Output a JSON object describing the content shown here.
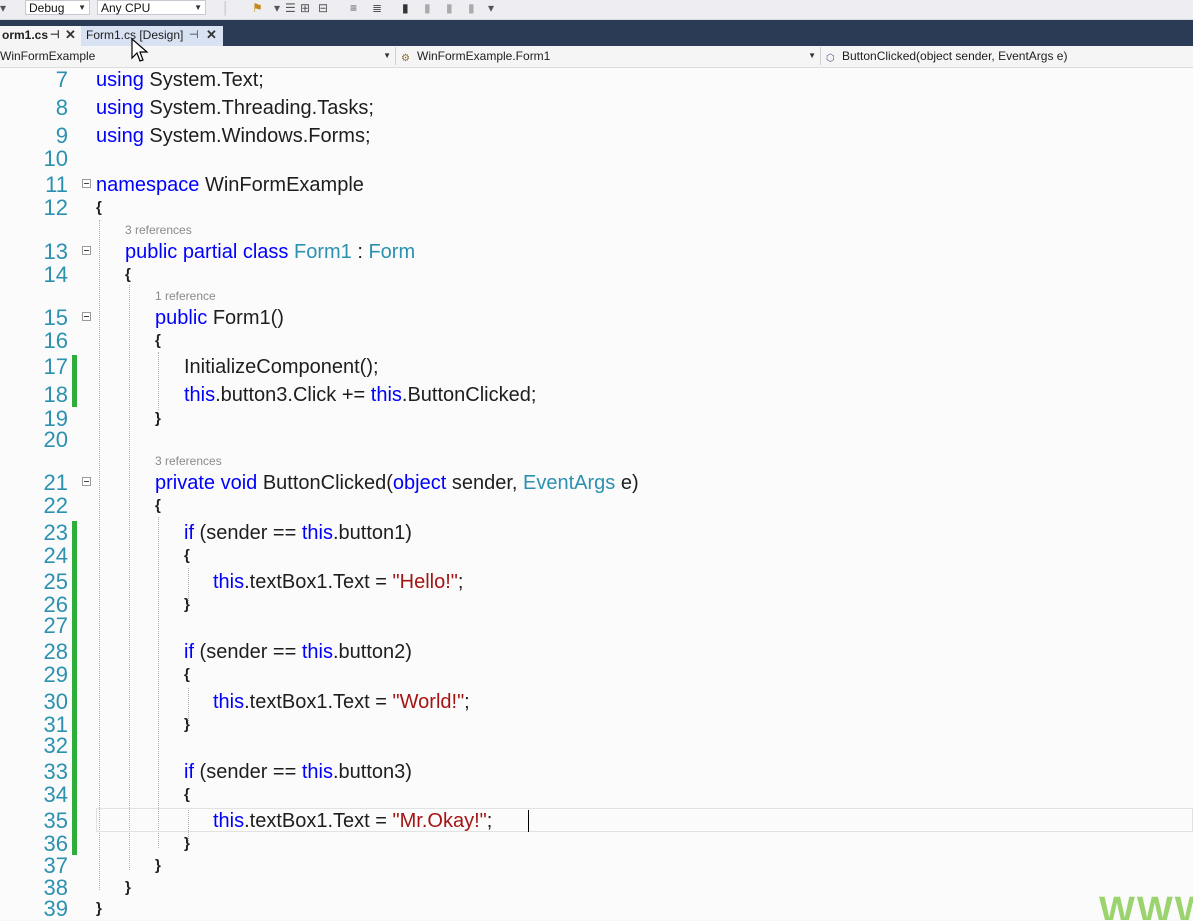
{
  "toolbar": {
    "configuration": "Debug",
    "platform": "Any CPU"
  },
  "tabs": [
    {
      "label": "orm1.cs",
      "active": true
    },
    {
      "label": "Form1.cs [Design]",
      "active": false
    }
  ],
  "navbar": {
    "project": "WinFormExample",
    "type": "WinFormExample.Form1",
    "member": "ButtonClicked(object sender, EventArgs e)"
  },
  "editor": {
    "lines": [
      {
        "n": "7"
      },
      {
        "n": "8"
      },
      {
        "n": "9"
      },
      {
        "n": "10"
      },
      {
        "n": "11"
      },
      {
        "n": "12"
      },
      {
        "n": "13"
      },
      {
        "n": "14"
      },
      {
        "n": "15"
      },
      {
        "n": "16"
      },
      {
        "n": "17"
      },
      {
        "n": "18"
      },
      {
        "n": "19"
      },
      {
        "n": "20"
      },
      {
        "n": "21"
      },
      {
        "n": "22"
      },
      {
        "n": "23"
      },
      {
        "n": "24"
      },
      {
        "n": "25"
      },
      {
        "n": "26"
      },
      {
        "n": "27"
      },
      {
        "n": "28"
      },
      {
        "n": "29"
      },
      {
        "n": "30"
      },
      {
        "n": "31"
      },
      {
        "n": "32"
      },
      {
        "n": "33"
      },
      {
        "n": "34"
      },
      {
        "n": "35"
      },
      {
        "n": "36"
      },
      {
        "n": "37"
      },
      {
        "n": "38"
      },
      {
        "n": "39"
      }
    ],
    "code": {
      "l7": [
        "using",
        " System.Text;"
      ],
      "l8": [
        "using",
        " System.Threading.Tasks;"
      ],
      "l9": [
        "using",
        " System.Windows.Forms;"
      ],
      "l11": [
        "namespace",
        " WinFormExample"
      ],
      "l12": "{",
      "l13": [
        "public partial class",
        " ",
        "Form1",
        " : ",
        "Form"
      ],
      "l14": "{",
      "l15": [
        "public",
        " Form1()"
      ],
      "l16": "{",
      "l17": "InitializeComponent();",
      "l18": [
        "this",
        ".button3.Click += ",
        "this",
        ".ButtonClicked;"
      ],
      "l19": "}",
      "l21": [
        "private void",
        " ButtonClicked(",
        "object",
        " sender, ",
        "EventArgs",
        " e)"
      ],
      "l22": "{",
      "l23": [
        "if",
        " (sender == ",
        "this",
        ".button1)"
      ],
      "l24": "{",
      "l25": [
        "this",
        ".textBox1.Text = ",
        "\"Hello!\"",
        ";"
      ],
      "l26": "}",
      "l28": [
        "if",
        " (sender == ",
        "this",
        ".button2)"
      ],
      "l29": "{",
      "l30": [
        "this",
        ".textBox1.Text = ",
        "\"World!\"",
        ";"
      ],
      "l31": "}",
      "l33": [
        "if",
        " (sender == ",
        "this",
        ".button3)"
      ],
      "l34": "{",
      "l35": [
        "this",
        ".textBox1.Text = ",
        "\"Mr.Okay!\"",
        ";"
      ],
      "l36": "}",
      "l37": "}",
      "l38": "}",
      "l39": "}"
    },
    "codelens": {
      "class_refs": "3 references",
      "ctor_refs": "1 reference",
      "method_refs": "3 references"
    }
  },
  "watermark": "WWW",
  "colors": {
    "keyword": "#0000ff",
    "type": "#2b91af",
    "string": "#a31515",
    "line_number": "#2b91af",
    "change_marker": "#2dae3b",
    "tab_bar": "#2b3a55"
  }
}
